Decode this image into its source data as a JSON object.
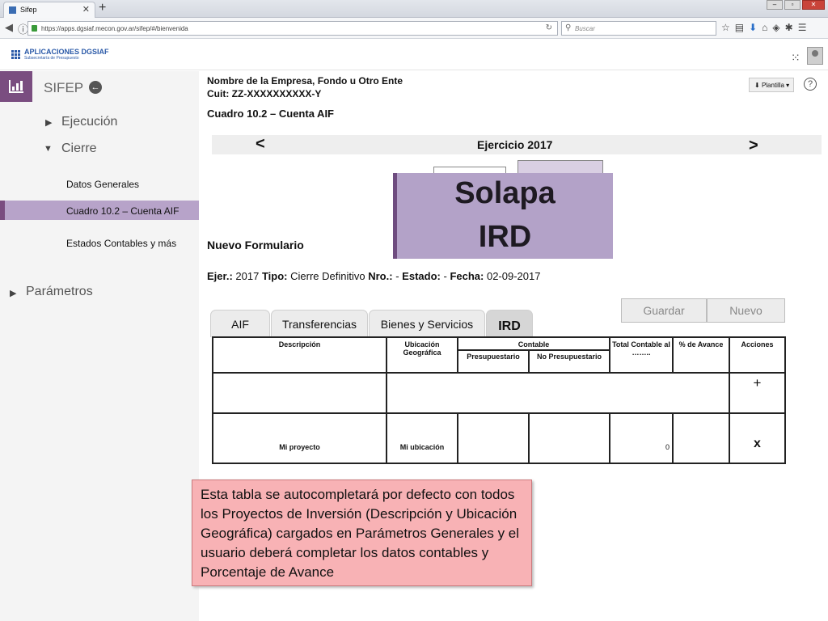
{
  "browser": {
    "tab_title": "Sifep",
    "tab_close": "✕",
    "new_tab": "+",
    "url": "https://apps.dgsiaf.mecon.gov.ar/sifep/#/bienvenida",
    "search_placeholder": "Buscar"
  },
  "header": {
    "logo_line1": "APLICACIONES DGSIAF",
    "logo_line2": "Subsecretaría de Presupuesto"
  },
  "sidebar": {
    "title": "SIFEP",
    "menu": {
      "ejecucion": "Ejecución",
      "cierre": "Cierre",
      "parametros": "Parámetros"
    },
    "cierre_items": [
      "Datos Generales",
      "Cuadro 10.2  – Cuenta AIF",
      "Estados Contables y más"
    ]
  },
  "main": {
    "company_line": "Nombre de la Empresa, Fondo u Otro Ente",
    "cuit_line": "Cuit: ZZ-XXXXXXXXXX-Y",
    "plantilla_label": "Plantilla",
    "cuadro_title": "Cuadro 10.2  – Cuenta AIF",
    "ejercicio": "Ejercicio 2017",
    "prev": "<",
    "next": ">",
    "overlay_line1": "Solapa",
    "overlay_line2": "IRD",
    "nuevo_formulario": "Nuevo Formulario",
    "meta": {
      "ejer_label": "Ejer.:",
      "ejer_value": "2017",
      "tipo_label": "Tipo:",
      "tipo_value": "Cierre Definitivo",
      "nro_label": "Nro.:",
      "nro_value": "-",
      "estado_label": "Estado:",
      "estado_value": "-",
      "fecha_label": "Fecha:",
      "fecha_value": "02-09-2017"
    },
    "buttons": {
      "guardar": "Guardar",
      "nuevo": "Nuevo"
    },
    "tabs": [
      "AIF",
      "Transferencias",
      "Bienes y Servicios",
      "IRD"
    ],
    "table": {
      "headers": {
        "descripcion": "Descripción",
        "ubicacion": "Ubicación Geográfica",
        "contable": "Contable",
        "presupuestario": "Presupuestario",
        "no_presupuestario": "No Presupuestario",
        "total_contable": "Total Contable al ……..",
        "avance": "% de Avance",
        "acciones": "Acciones"
      },
      "add_symbol": "+",
      "row": {
        "descripcion": "Mi proyecto",
        "ubicacion": "Mi ubicación",
        "total": "0",
        "delete_symbol": "x"
      }
    },
    "callout": "Esta tabla se autocompletará por defecto con todos los Proyectos de Inversión  (Descripción y Ubicación Geográfica) cargados en Parámetros Generales y el usuario deberá completar los datos contables y Porcentaje de Avance"
  }
}
